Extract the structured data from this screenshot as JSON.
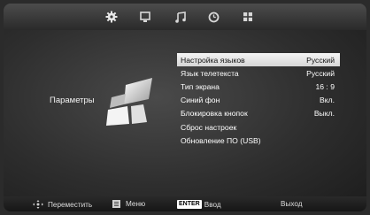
{
  "tabs": [
    {
      "icon": "gear-icon"
    },
    {
      "icon": "monitor-icon"
    },
    {
      "icon": "music-note-icon"
    },
    {
      "icon": "clock-icon"
    },
    {
      "icon": "grid-icon"
    }
  ],
  "section": {
    "label": "Параметры"
  },
  "menu": {
    "items": [
      {
        "label": "Настройка языков",
        "value": "Русский",
        "selected": true
      },
      {
        "label": "Язык телетекста",
        "value": "Русский"
      },
      {
        "label": "Тип экрана",
        "value": "16 : 9"
      },
      {
        "label": "Синий фон",
        "value": "Вкл."
      },
      {
        "label": "Блокировка кнопок",
        "value": "Выкл."
      },
      {
        "label": "Сброс настроек",
        "value": ""
      },
      {
        "label": "Обновление ПО (USB)",
        "value": ""
      }
    ]
  },
  "footer": {
    "move": "Переместить",
    "menu": "Меню",
    "enter_key": "ENTER",
    "enter": "Ввод",
    "exit": "Выход"
  },
  "colors": {
    "highlight": "#e8e8e8",
    "background": "#3a3a3a"
  }
}
